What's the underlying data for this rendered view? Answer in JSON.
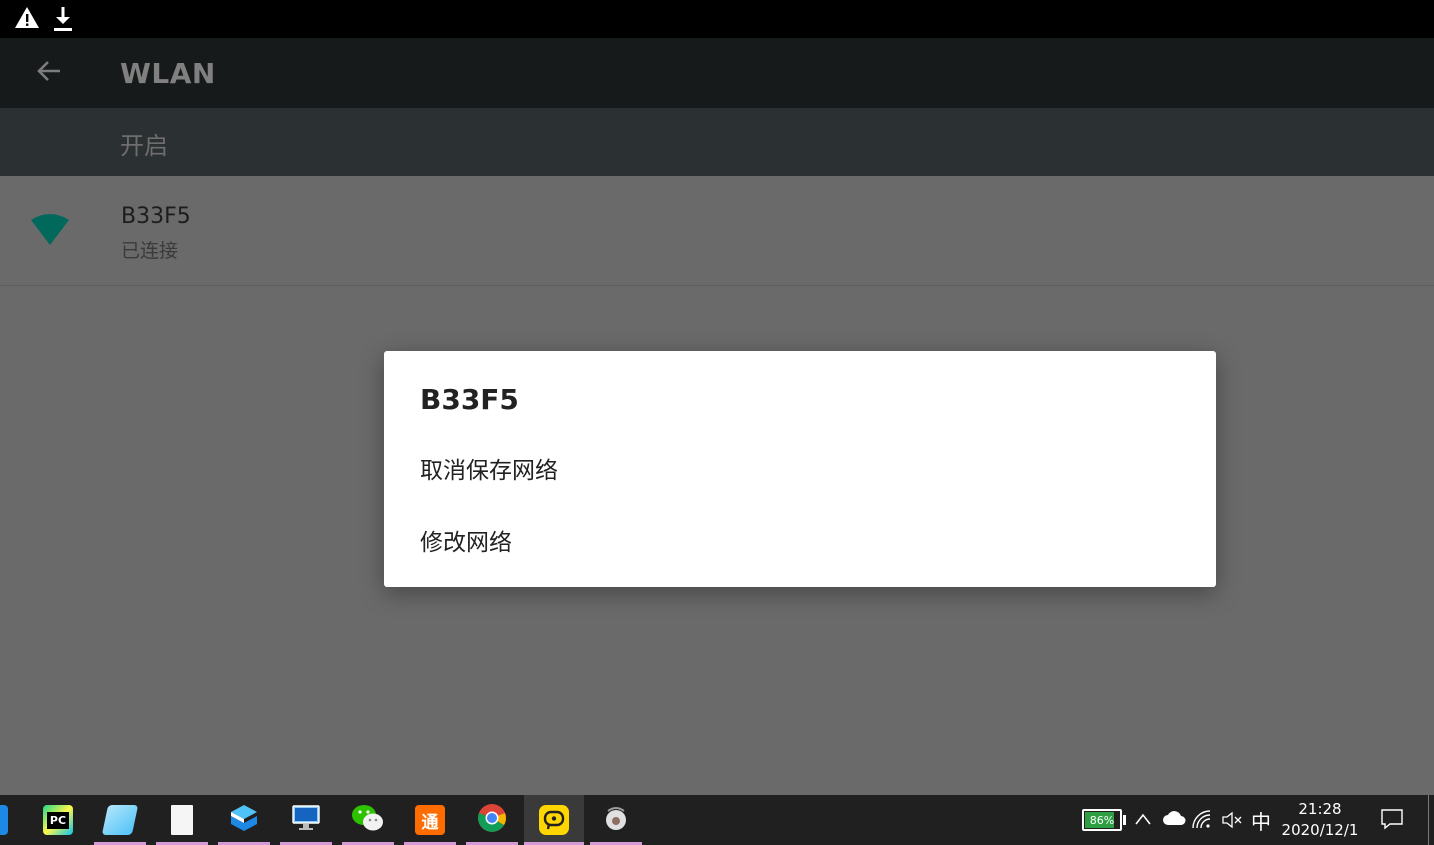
{
  "status_bar": {
    "icons": [
      "warning-icon",
      "download-icon"
    ]
  },
  "app_bar": {
    "back_icon": "arrow-back-icon",
    "title": "WLAN"
  },
  "switch_bar": {
    "label": "开启"
  },
  "networks": [
    {
      "name": "B33F5",
      "status": "已连接",
      "icon": "wifi-signal-icon"
    }
  ],
  "dialog": {
    "title": "B33F5",
    "items": [
      {
        "label": "取消保存网络"
      },
      {
        "label": "修改网络"
      }
    ]
  },
  "taskbar": {
    "apps": [
      {
        "name": "pycharm",
        "glyph": "PC"
      },
      {
        "name": "notepad",
        "glyph": ""
      },
      {
        "name": "file",
        "glyph": ""
      },
      {
        "name": "box-3d",
        "glyph": ""
      },
      {
        "name": "remote-desktop",
        "glyph": ""
      },
      {
        "name": "wechat",
        "glyph": ""
      },
      {
        "name": "tong",
        "glyph": "通"
      },
      {
        "name": "chrome",
        "glyph": ""
      },
      {
        "name": "emulator",
        "glyph": ""
      },
      {
        "name": "pot",
        "glyph": ""
      }
    ],
    "tray": {
      "battery": "86%",
      "battery_level": 0.86,
      "ime": "中",
      "time": "21:28",
      "date": "2020/12/1"
    }
  },
  "colors": {
    "wifi_green": "#00695c",
    "battery_green": "#2ea043",
    "active_underline": "#d49ad6"
  }
}
